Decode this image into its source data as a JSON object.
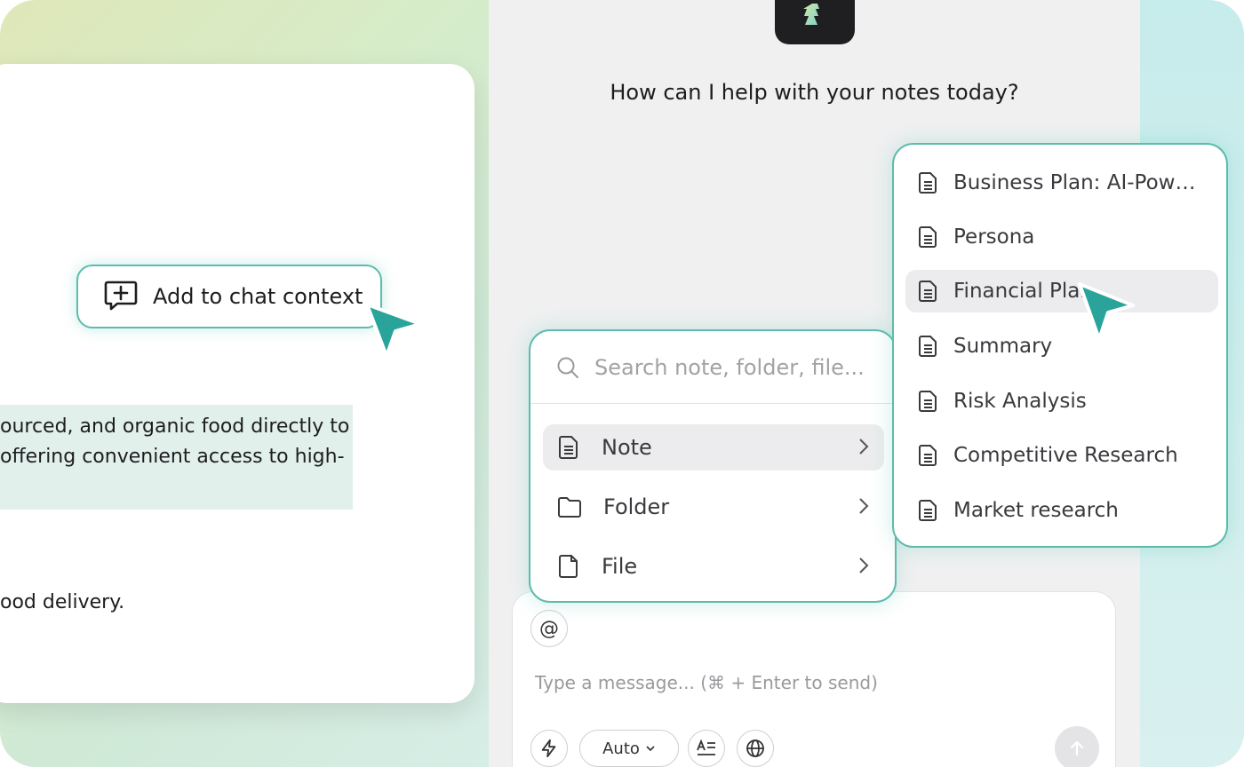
{
  "note": {
    "highlighted_lines": [
      "ourced, and organic food directly to",
      " offering convenient access to high-"
    ],
    "trailing_line": "ood delivery.",
    "context_button_label": "Add to chat context"
  },
  "chat": {
    "greeting": "How can I help with your notes today?",
    "composer": {
      "mention_symbol": "@",
      "placeholder": "Type a message... (⌘ + Enter to send)",
      "model_selector": "Auto"
    }
  },
  "search_popover": {
    "placeholder": "Search note, folder, file...",
    "types": [
      {
        "label": "Note",
        "active": true
      },
      {
        "label": "Folder",
        "active": false
      },
      {
        "label": "File",
        "active": false
      }
    ]
  },
  "notes_popover": {
    "items": [
      {
        "label": "Business Plan: AI-Powe..."
      },
      {
        "label": "Persona"
      },
      {
        "label": "Financial Plan",
        "active": true
      },
      {
        "label": "Summary"
      },
      {
        "label": "Risk Analysis"
      },
      {
        "label": "Competitive Research"
      },
      {
        "label": "Market research"
      }
    ]
  },
  "colors": {
    "accent": "#5cbcad",
    "cursor": "#2aa49a",
    "highlight": "#e2f0ec"
  }
}
